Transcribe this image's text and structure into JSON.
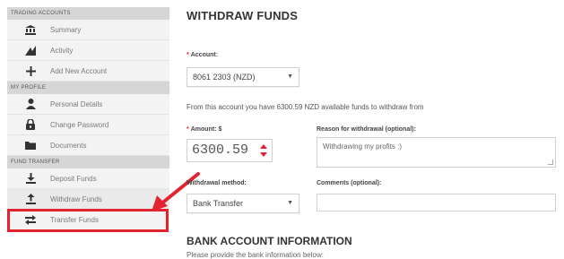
{
  "sidebar": {
    "sections": [
      {
        "header": "Trading Accounts",
        "items": [
          {
            "label": "Summary",
            "icon": "bank-icon"
          },
          {
            "label": "Activity",
            "icon": "chart-icon"
          },
          {
            "label": "Add New Account",
            "icon": "plus-icon"
          }
        ]
      },
      {
        "header": "My Profile",
        "items": [
          {
            "label": "Personal Details",
            "icon": "user-icon"
          },
          {
            "label": "Change Password",
            "icon": "lock-icon"
          },
          {
            "label": "Documents",
            "icon": "folder-icon"
          }
        ]
      },
      {
        "header": "Fund Transfer",
        "items": [
          {
            "label": "Deposit Funds",
            "icon": "download-icon"
          },
          {
            "label": "Withdraw Funds",
            "icon": "upload-icon"
          },
          {
            "label": "Transfer Funds",
            "icon": "transfer-icon"
          }
        ]
      }
    ]
  },
  "main": {
    "title": "WITHDRAW FUNDS",
    "account_label": "Account:",
    "account_value": "8061 2303 (NZD)",
    "info_text": "From this account you have 6300.59 NZD available funds to withdraw from",
    "amount_label": "Amount: $",
    "amount_value": "6300.59",
    "reason_label": "Reason for withdrawal (optional):",
    "reason_value": "Withdrawing my profits :)",
    "method_label": "Withdrawal method:",
    "method_value": "Bank Transfer",
    "comments_label": "Comments (optional):",
    "comments_value": "",
    "bank_section_title": "BANK ACCOUNT INFORMATION",
    "bank_section_sub": "Please provide the bank information below:"
  },
  "colors": {
    "highlight": "#e3232f",
    "sidebar_bg": "#f3f3f3",
    "section_header_bg": "#d6d6d6"
  }
}
